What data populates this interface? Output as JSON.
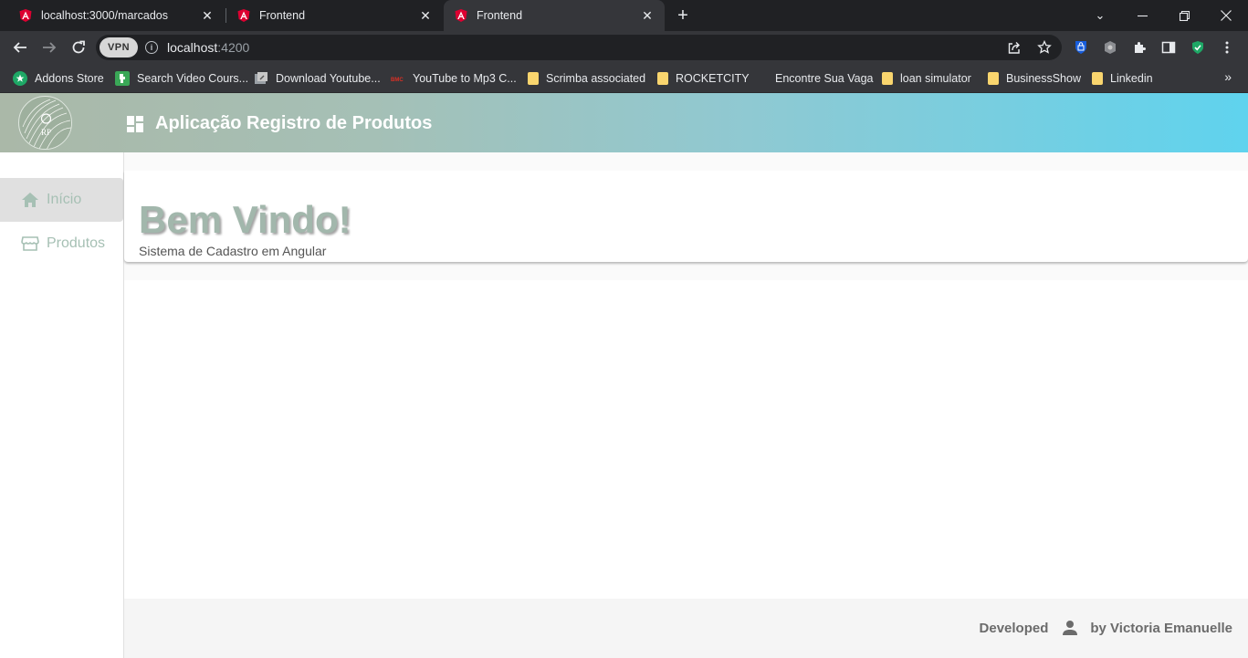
{
  "browser": {
    "tabs": [
      {
        "title": "localhost:3000/marcados",
        "active": false
      },
      {
        "title": "Frontend",
        "active": false
      },
      {
        "title": "Frontend",
        "active": true
      }
    ],
    "address": {
      "vpn_label": "VPN",
      "host": "localhost",
      "port": ":4200"
    },
    "bookmarks": [
      {
        "label": "Addons Store",
        "icon": "addons-icon"
      },
      {
        "label": "Search Video Cours...",
        "icon": "video-icon"
      },
      {
        "label": "Download Youtube...",
        "icon": "download-icon"
      },
      {
        "label": "YouTube to Mp3 C...",
        "icon": "mp3-icon"
      },
      {
        "label": "Scrimba associated",
        "icon": "folder-icon"
      },
      {
        "label": "ROCKETCITY",
        "icon": "folder-icon"
      },
      {
        "label": "Encontre Sua Vaga",
        "icon": "none"
      },
      {
        "label": "loan simulator",
        "icon": "folder-icon"
      },
      {
        "label": "BusinessShow",
        "icon": "folder-icon"
      },
      {
        "label": "Linkedin",
        "icon": "folder-icon"
      }
    ]
  },
  "app": {
    "header": {
      "title": "Aplicação Registro de Produtos",
      "logo_text": "RP"
    },
    "sidebar": {
      "items": [
        {
          "label": "Início",
          "icon": "home-icon",
          "active": true
        },
        {
          "label": "Produtos",
          "icon": "store-icon",
          "active": false
        }
      ]
    },
    "hero": {
      "title": "Bem Vindo!",
      "subtitle": "Sistema de Cadastro em Angular"
    },
    "footer": {
      "developed": "Developed",
      "author": "by Victoria Emanuelle"
    }
  },
  "colors": {
    "accent": "#a6c0b4",
    "header_start": "#aab8a8",
    "header_end": "#5fd3ee"
  }
}
